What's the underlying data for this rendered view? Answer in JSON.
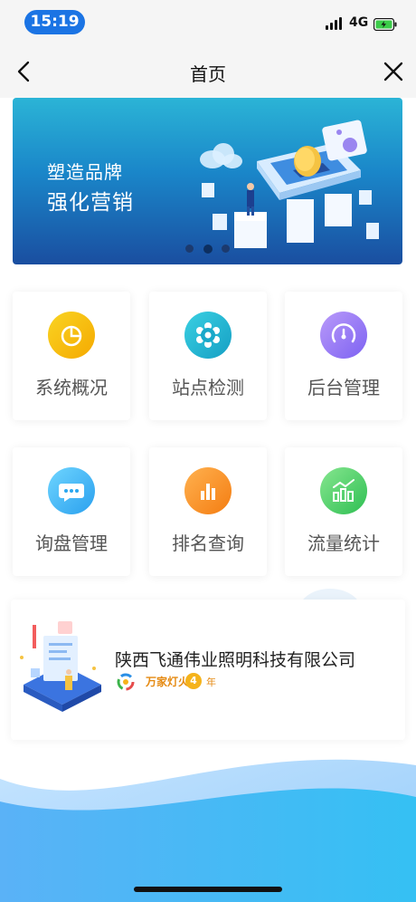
{
  "status": {
    "time": "15:19",
    "network": "4G"
  },
  "nav": {
    "title": "首页"
  },
  "banner": {
    "line1": "塑造品牌",
    "line2": "强化营销",
    "active_dot": 1,
    "dot_count": 3
  },
  "grid": [
    {
      "label": "系统概况",
      "icon": "pie-chart-icon",
      "color_from": "#f9d423",
      "color_to": "#f7b500"
    },
    {
      "label": "站点检测",
      "icon": "gear-icon",
      "color_from": "#3ad0e2",
      "color_to": "#19a8c9"
    },
    {
      "label": "后台管理",
      "icon": "gauge-icon",
      "color_from": "#b38bfa",
      "color_to": "#8d6ef5"
    },
    {
      "label": "询盘管理",
      "icon": "chat-bubble-icon",
      "color_from": "#5ccfff",
      "color_to": "#2aa7f0"
    },
    {
      "label": "排名查询",
      "icon": "bar-chart-icon",
      "color_from": "#ffae4b",
      "color_to": "#f7861c"
    },
    {
      "label": "流量统计",
      "icon": "trend-chart-icon",
      "color_from": "#7ee089",
      "color_to": "#34c759"
    }
  ],
  "company": {
    "name": "陕西飞通伟业照明科技有限公司",
    "badge_text": "万家灯火",
    "years": "4",
    "years_unit": "年"
  }
}
